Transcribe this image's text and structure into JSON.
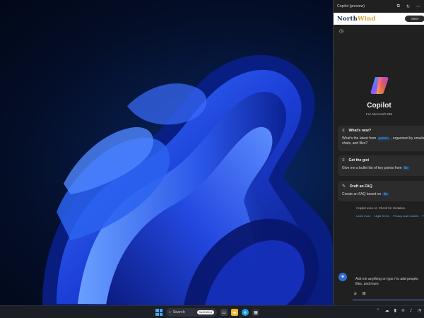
{
  "copilot": {
    "window_title": "Copilot (preview)",
    "titlebar_icons": [
      "popout-icon",
      "refresh-icon",
      "more-icon"
    ],
    "brand": {
      "part1": "North",
      "part2": "Wind",
      "button_label": "Meet",
      "colors": {
        "north": "#1a2e4a",
        "wind": "#d2a129"
      }
    },
    "history_icon": "history-icon",
    "title": "Copilot",
    "subtitle": "For Microsoft 365",
    "cards": [
      {
        "icon": "list-icon",
        "title": "What's new?",
        "text_before": "What's the latest from",
        "chip": "person",
        "text_after": ", organized by emails, chats, and files?"
      },
      {
        "icon": "list-icon",
        "title": "Get the gist",
        "text_before": "Give me a bullet list of key points from",
        "chip": "file",
        "text_after": ""
      },
      {
        "icon": "pencil-icon",
        "title": "Draft an FAQ",
        "text_before": "Create an FAQ based on",
        "chip": "file",
        "text_after": ""
      }
    ],
    "disclaimer": "Copilot uses AI. Check for mistakes.",
    "links": [
      "Learn more",
      "Legal Terms",
      "Privacy and Cookies",
      "F"
    ],
    "prompt_placeholder": "Ask me anything or type / to add people, files, and more",
    "prompt_tools": [
      "attach-icon",
      "plus-icon"
    ]
  },
  "taskbar": {
    "search_label": "Search",
    "search_pill": "NorthWind",
    "accent": "#4ba3f2",
    "apps": [
      "task-view-icon",
      "file-explorer-icon",
      "edge-icon",
      "store-icon"
    ],
    "tray_icons": [
      "chevron-up-icon",
      "cloud-icon",
      "battery-icon",
      "wifi-icon",
      "volume-icon",
      "bell-icon"
    ]
  }
}
